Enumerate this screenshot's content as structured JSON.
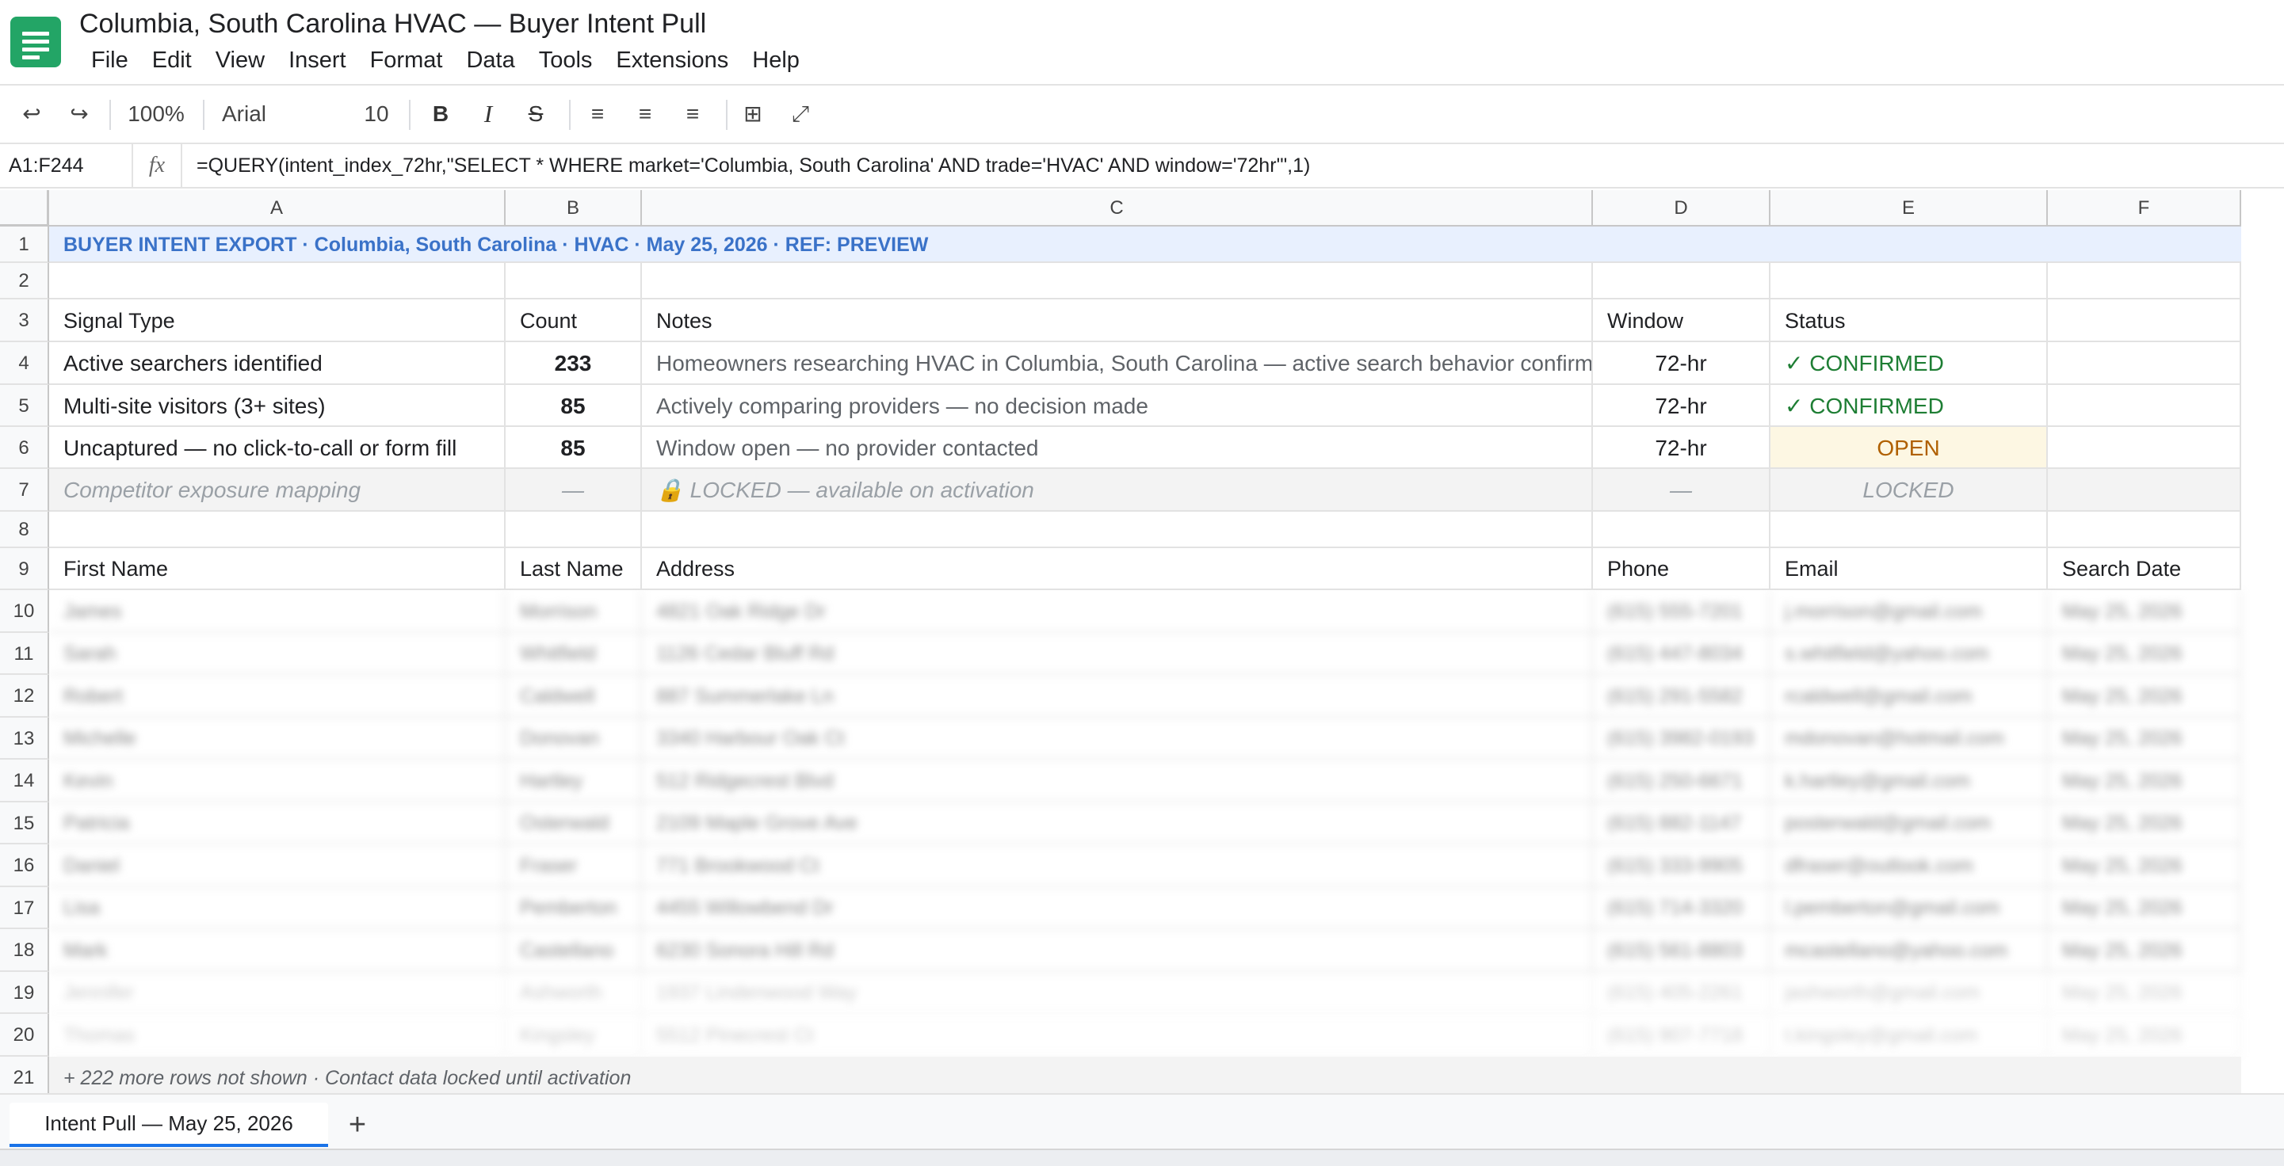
{
  "app": {
    "title": "Columbia, South Carolina HVAC — Buyer Intent Pull",
    "logo_icon": "sheets-logo-icon",
    "accent": "#23a566"
  },
  "menu": [
    "File",
    "Edit",
    "View",
    "Insert",
    "Format",
    "Data",
    "Tools",
    "Extensions",
    "Help"
  ],
  "toolbar": {
    "undo": "↩",
    "redo": "↪",
    "zoom": "100%",
    "font": "Arial",
    "font_size": "10",
    "bold": "B",
    "italic": "I",
    "strike": "S",
    "align_left": "≡",
    "align_center": "≡",
    "align_right": "≡",
    "borders": "⊞",
    "expand": "⤢"
  },
  "formula_bar": {
    "name_box": "A1:F244",
    "fx": "fx",
    "formula": "=QUERY(intent_index_72hr,\"SELECT * WHERE market='Columbia, South Carolina' AND trade='HVAC' AND window='72hr'\",1)"
  },
  "columns": [
    "A",
    "B",
    "C",
    "D",
    "E",
    "F"
  ],
  "row_numbers": [
    "1",
    "2",
    "3",
    "4",
    "5",
    "6",
    "7",
    "8",
    "9",
    "10",
    "11",
    "12",
    "13",
    "14",
    "15",
    "16",
    "17",
    "18",
    "19",
    "20",
    "21"
  ],
  "banner": "BUYER INTENT EXPORT  ·  Columbia, South Carolina  ·  HVAC  ·  May 25, 2026  ·  REF: PREVIEW",
  "signals": {
    "headers": {
      "type": "Signal Type",
      "count": "Count",
      "notes": "Notes",
      "window": "Window",
      "status": "Status"
    },
    "rows": [
      {
        "type": "Active searchers identified",
        "count": "233",
        "notes": "Homeowners researching HVAC in Columbia, South Carolina — active search behavior confirmed",
        "window": "72-hr",
        "status": "✓ CONFIRMED"
      },
      {
        "type": "Multi-site visitors (3+ sites)",
        "count": "85",
        "notes": "Actively comparing providers — no decision made",
        "window": "72-hr",
        "status": "✓ CONFIRMED"
      },
      {
        "type": "Uncaptured — no click-to-call or form fill",
        "count": "85",
        "notes": "Window open — no provider contacted",
        "window": "72-hr",
        "status": "OPEN"
      },
      {
        "type": "Competitor exposure mapping",
        "count": "—",
        "notes": "🔒 LOCKED — available on activation",
        "window": "—",
        "status": "LOCKED"
      }
    ]
  },
  "contacts": {
    "headers": {
      "first": "First Name",
      "last": "Last Name",
      "address": "Address",
      "phone": "Phone",
      "email": "Email",
      "date": "Search Date"
    },
    "rows": [
      {
        "first": "James",
        "last": "Morrison",
        "address": "4821 Oak Ridge Dr",
        "phone": "(615) 555-7201",
        "email": "j.morrison@gmail.com",
        "date": "May 25, 2026"
      },
      {
        "first": "Sarah",
        "last": "Whitfield",
        "address": "1126 Cedar Bluff Rd",
        "phone": "(615) 447-8034",
        "email": "s.whitfield@yahoo.com",
        "date": "May 25, 2026"
      },
      {
        "first": "Robert",
        "last": "Caldwell",
        "address": "887 Summerlake Ln",
        "phone": "(615) 291-5582",
        "email": "rcaldwell@gmail.com",
        "date": "May 25, 2026"
      },
      {
        "first": "Michelle",
        "last": "Donovan",
        "address": "3340 Harbour Oak Ct",
        "phone": "(615) 3982-0193",
        "email": "mdonovan@hotmail.com",
        "date": "May 25, 2026"
      },
      {
        "first": "Kevin",
        "last": "Hartley",
        "address": "512 Ridgecrest Blvd",
        "phone": "(615) 250-6671",
        "email": "k.hartley@gmail.com",
        "date": "May 25, 2026"
      },
      {
        "first": "Patricia",
        "last": "Osterwald",
        "address": "2109 Maple Grove Ave",
        "phone": "(615) 882-1147",
        "email": "posterwald@gmail.com",
        "date": "May 25, 2026"
      },
      {
        "first": "Daniel",
        "last": "Fraser",
        "address": "771 Brookwood Ct",
        "phone": "(615) 333-9905",
        "email": "dfraser@outlook.com",
        "date": "May 25, 2026"
      },
      {
        "first": "Lisa",
        "last": "Pemberton",
        "address": "4455 Willowbend Dr",
        "phone": "(615) 714-3320",
        "email": "l.pemberton@gmail.com",
        "date": "May 25, 2026"
      },
      {
        "first": "Mark",
        "last": "Castellano",
        "address": "6230 Sonora Hill Rd",
        "phone": "(615) 561-8803",
        "email": "mcastellano@yahoo.com",
        "date": "May 25, 2026"
      },
      {
        "first": "Jennifer",
        "last": "Ashworth",
        "address": "1937 Lindenwood Way",
        "phone": "(615) 405-2261",
        "email": "jashworth@gmail.com",
        "date": "May 25, 2026"
      },
      {
        "first": "Thomas",
        "last": "Kingsley",
        "address": "5512 Pinecrest Ct",
        "phone": "(615) 907-7718",
        "email": "t.kingsley@gmail.com",
        "date": "May 25, 2026"
      }
    ]
  },
  "footer": "+ 222 more rows not shown  ·  Contact data locked until activation",
  "sheet_tab": "Intent Pull — May 25, 2026",
  "add_sheet": "+",
  "colors": {
    "banner_bg": "#e8f0fe",
    "banner_text": "#3a72c8",
    "confirmed": "#1e7e34",
    "open": "#b06000",
    "open_bg": "#fdf7e3",
    "active_tab": "#1a73e8"
  }
}
